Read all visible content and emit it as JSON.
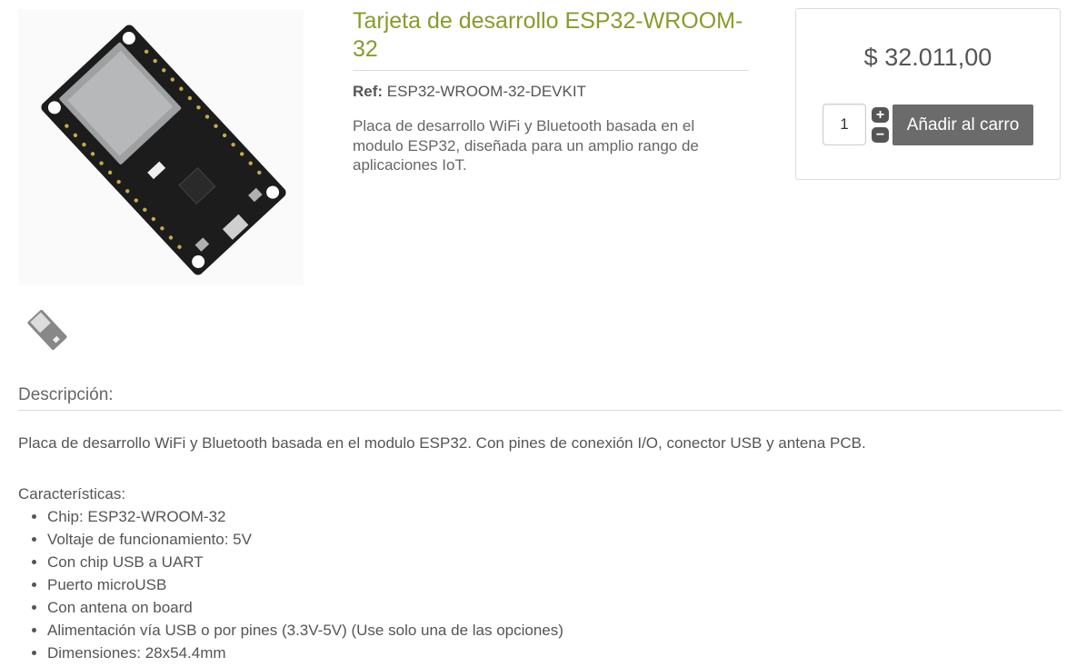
{
  "product": {
    "title": "Tarjeta de desarrollo ESP32-WROOM-32",
    "ref_label": "Ref:",
    "ref_value": "ESP32-WROOM-32-DEVKIT",
    "short_description": "Placa de desarrollo WiFi y Bluetooth basada en el modulo ESP32, diseñada para un amplio rango de aplicaciones IoT.",
    "image_icon": "esp32-board-image",
    "thumbnail_icon": "esp32-board-thumbnail"
  },
  "buy_box": {
    "price": "$ 32.011,00",
    "quantity": "1",
    "increment_symbol": "+",
    "decrement_symbol": "−",
    "add_to_cart_label": "Añadir al carro",
    "button_color": "#6b6b6b"
  },
  "description": {
    "heading": "Descripción:",
    "text": "Placa de desarrollo WiFi y Bluetooth basada en el modulo ESP32. Con pines de conexión I/O, conector USB y antena PCB.",
    "features_heading": "Características:",
    "features": [
      "Chip: ESP32-WROOM-32",
      "Voltaje de funcionamiento: 5V",
      "Con chip USB a UART",
      "Puerto microUSB",
      "Con antena on board",
      "Alimentación vía USB o por pines (3.3V-5V) (Use solo una de las opciones)",
      "Dimensiones: 28x54.4mm"
    ]
  },
  "colors": {
    "title": "#8a9a2a",
    "text": "#555555",
    "border": "#dcdcdc"
  }
}
